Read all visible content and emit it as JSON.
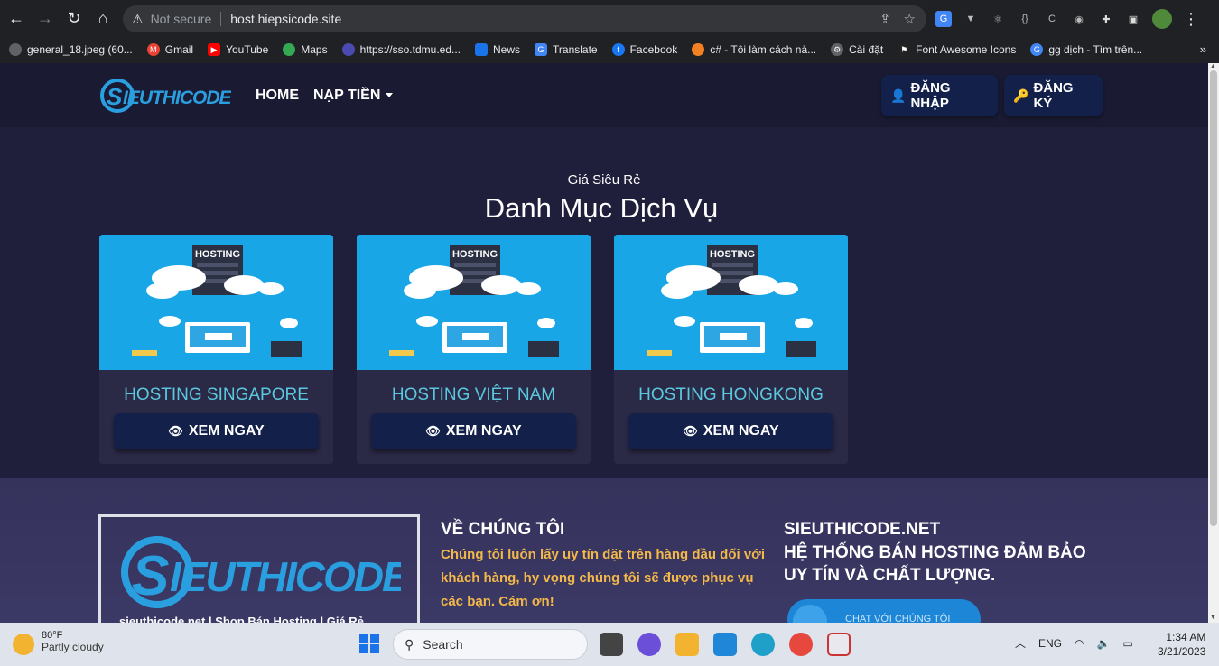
{
  "browser": {
    "security_label": "Not secure",
    "url": "host.hiepsicode.site",
    "bookmarks": [
      {
        "label": "general_18.jpeg (60...",
        "color": "#5f6368"
      },
      {
        "label": "Gmail",
        "color": "#ea4335"
      },
      {
        "label": "YouTube",
        "color": "#ff0000"
      },
      {
        "label": "Maps",
        "color": "#34a853"
      },
      {
        "label": "https://sso.tdmu.ed...",
        "color": "#4a4ab0"
      },
      {
        "label": "News",
        "color": "#1a73e8"
      },
      {
        "label": "Translate",
        "color": "#4285f4"
      },
      {
        "label": "Facebook",
        "color": "#1877f2"
      },
      {
        "label": "c# - Tôi làm cách nà...",
        "color": "#f48024"
      },
      {
        "label": "Cài đặt",
        "color": "#5f6368"
      },
      {
        "label": "Font Awesome Icons",
        "color": "#222"
      },
      {
        "label": "gg dịch - Tìm trên...",
        "color": "#4285f4"
      }
    ],
    "more_label": "»"
  },
  "site": {
    "nav": {
      "home": "HOME",
      "deposit": "NẠP TIỀN",
      "login": "ĐĂNG NHẬP",
      "register": "ĐĂNG KÝ"
    },
    "section_subtitle": "Giá Siêu Rẻ",
    "section_title": "Danh Mục Dịch Vụ",
    "cards": [
      {
        "title": "HOSTING SINGAPORE",
        "image_label": "HOSTING",
        "button": "XEM NGAY"
      },
      {
        "title": "HOSTING VIỆT NAM",
        "image_label": "HOSTING",
        "button": "XEM NGAY"
      },
      {
        "title": "HOSTING HONGKONG",
        "image_label": "HOSTING",
        "button": "XEM NGAY"
      }
    ],
    "footer": {
      "tagline": "sieuthicode.net | Shop Bán Hosting | Giá Rẻ",
      "about_title": "VỀ CHÚNG TÔI",
      "about_text": "Chúng tôi luôn lấy uy tín đặt trên hàng đầu đối với khách hàng, hy vọng chúng tôi sẽ được phục vụ các bạn. Cám ơn!",
      "brand_title": "SIEUTHICODE.NET",
      "brand_text": "HỆ THỐNG BÁN HOSTING ĐẢM BẢO UY TÍN VÀ CHẤT LƯỢNG.",
      "chat_label": "CHAT VỚI CHÚNG TÔI"
    },
    "colors": {
      "accent": "#5cc8df",
      "button_bg": "#13214a",
      "about_text": "#f4b84a"
    }
  },
  "taskbar": {
    "temperature": "80°F",
    "weather": "Partly cloudy",
    "search_placeholder": "Search",
    "lang": "ENG",
    "time": "1:34 AM",
    "date": "3/21/2023"
  }
}
